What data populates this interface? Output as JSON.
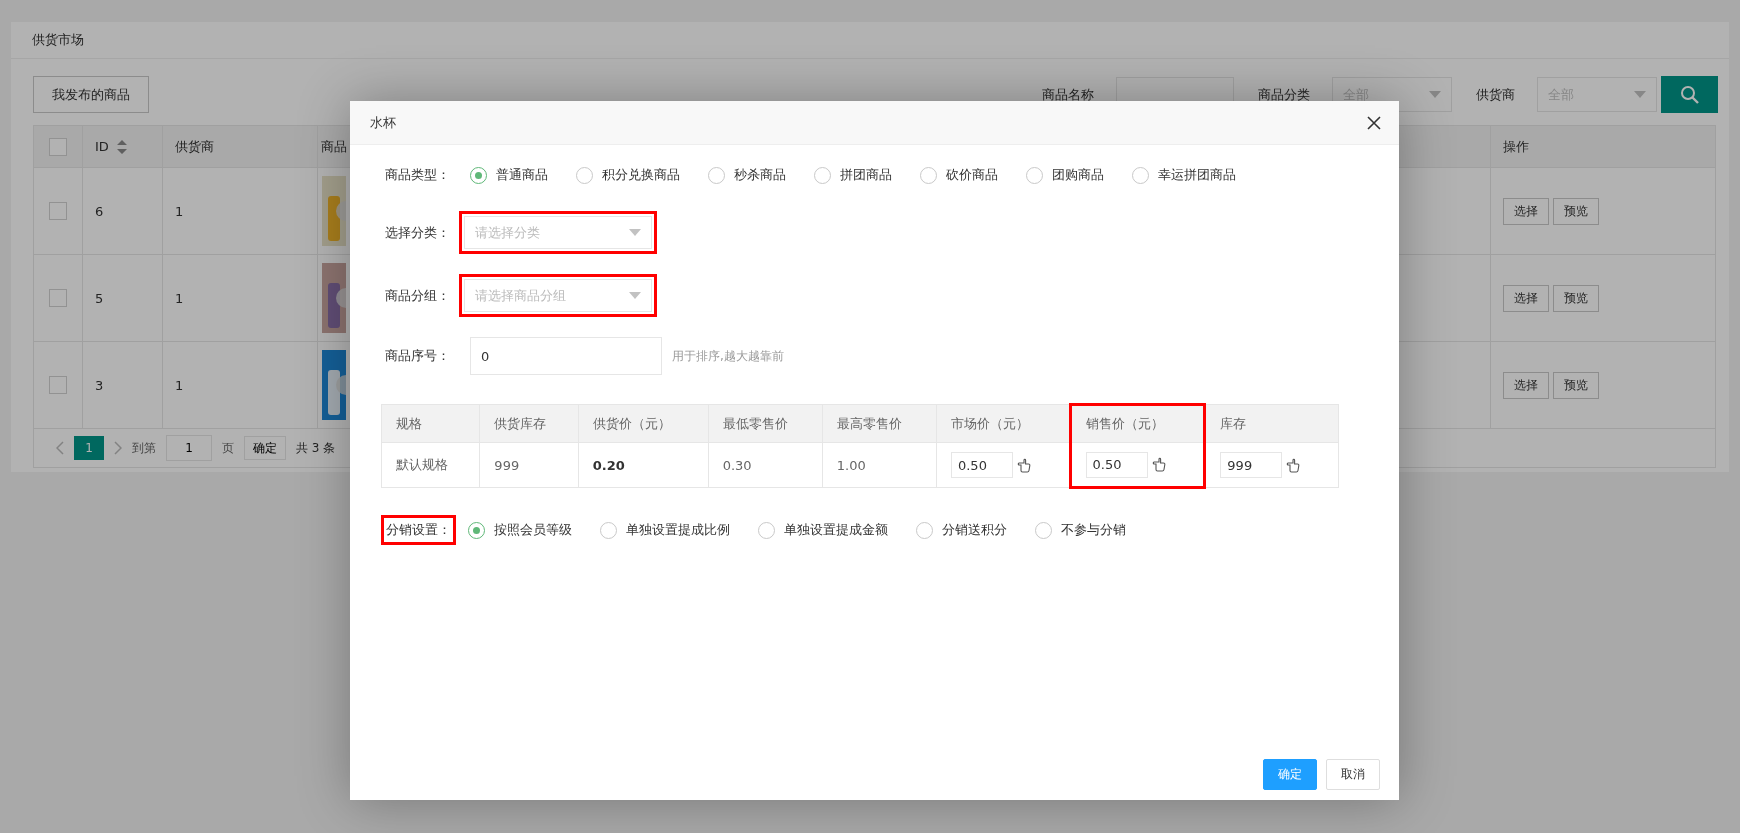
{
  "page": {
    "title": "供货市场",
    "my_goods_button": "我发布的商品",
    "filters": [
      {
        "label": "商品名称",
        "kind": "text"
      },
      {
        "label": "商品分类",
        "kind": "select",
        "placeholder": "全部"
      },
      {
        "label": "供货商",
        "kind": "select",
        "placeholder": "全部"
      }
    ],
    "table": {
      "all_checked": false,
      "columns": [
        "ID",
        "供货商",
        "商品",
        "操作"
      ],
      "rows": [
        {
          "id": "6",
          "supplier": "1",
          "checked": false,
          "actions": [
            "选择",
            "预览"
          ]
        },
        {
          "id": "5",
          "supplier": "1",
          "checked": false,
          "actions": [
            "选择",
            "预览"
          ]
        },
        {
          "id": "3",
          "supplier": "1",
          "checked": false,
          "actions": [
            "选择",
            "预览"
          ]
        }
      ]
    },
    "pager": {
      "pages": [
        {
          "label": "1",
          "selected": true
        }
      ],
      "goto_label": "到第",
      "page_value": "1",
      "page_unit": "页",
      "confirm": "确定",
      "total": "共 3 条"
    }
  },
  "dialog": {
    "title": "水杯",
    "fields": [
      {
        "label": "商品类型：",
        "kind": "radios",
        "options": [
          {
            "label": "普通商品",
            "selected": true
          },
          {
            "label": "积分兑换商品",
            "selected": false
          },
          {
            "label": "秒杀商品",
            "selected": false
          },
          {
            "label": "拼团商品",
            "selected": false
          },
          {
            "label": "砍价商品",
            "selected": false
          },
          {
            "label": "团购商品",
            "selected": false
          },
          {
            "label": "幸运拼团商品",
            "selected": false
          }
        ]
      },
      {
        "label": "选择分类：",
        "kind": "select",
        "placeholder": "请选择分类",
        "highlighted": true
      },
      {
        "label": "商品分组：",
        "kind": "select",
        "placeholder": "请选择商品分组",
        "highlighted": true
      },
      {
        "label": "商品序号：",
        "kind": "input",
        "value": "0",
        "hint": "用于排序,越大越靠前"
      }
    ],
    "spec_table": {
      "columns": [
        {
          "label": "规格",
          "highlighted": false
        },
        {
          "label": "供货库存",
          "highlighted": false
        },
        {
          "label": "供货价（元）",
          "highlighted": false
        },
        {
          "label": "最低零售价",
          "highlighted": false
        },
        {
          "label": "最高零售价",
          "highlighted": false
        },
        {
          "label": "市场价（元）",
          "highlighted": false
        },
        {
          "label": "销售价（元）",
          "highlighted": true
        },
        {
          "label": "库存",
          "highlighted": false
        }
      ],
      "rows": [
        [
          {
            "kind": "text",
            "text": "默认规格"
          },
          {
            "kind": "text",
            "text": "999"
          },
          {
            "kind": "bold",
            "text": "0.20"
          },
          {
            "kind": "text",
            "text": "0.30"
          },
          {
            "kind": "text",
            "text": "1.00"
          },
          {
            "kind": "input",
            "text": "0.50"
          },
          {
            "kind": "input",
            "text": "0.50"
          },
          {
            "kind": "input",
            "text": "999"
          }
        ]
      ]
    },
    "distribution": {
      "label": "分销设置：",
      "highlighted": true,
      "options": [
        {
          "label": "按照会员等级",
          "selected": true
        },
        {
          "label": "单独设置提成比例",
          "selected": false
        },
        {
          "label": "单独设置提成金额",
          "selected": false
        },
        {
          "label": "分销送积分",
          "selected": false
        },
        {
          "label": "不参与分销",
          "selected": false
        }
      ]
    },
    "buttons": [
      {
        "label": "确定",
        "kind": "primary"
      },
      {
        "label": "取消",
        "kind": "default"
      }
    ]
  }
}
